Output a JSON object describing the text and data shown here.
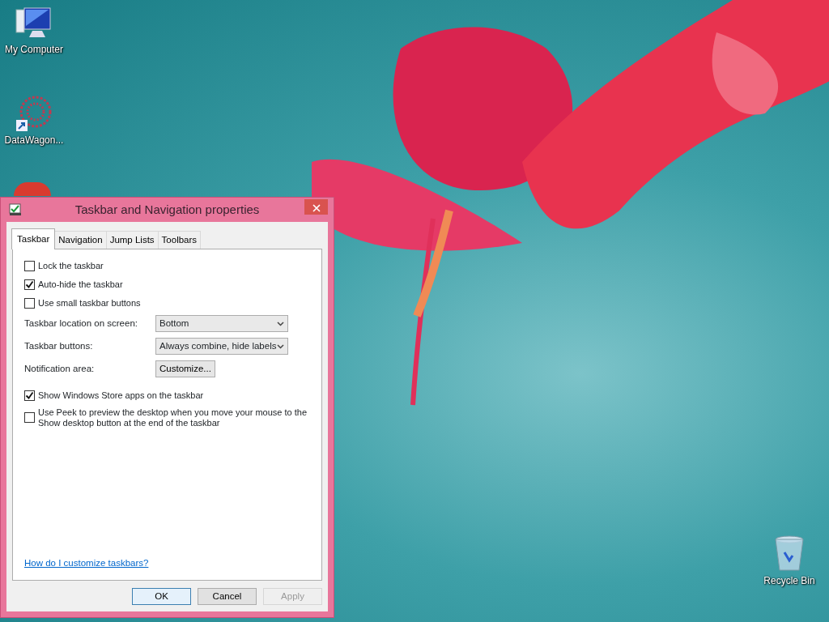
{
  "desktop_icons": [
    {
      "label": "My Computer",
      "kind": "computer"
    },
    {
      "label": "DataWagon...",
      "kind": "shortcut"
    },
    {
      "label": "Recycle Bin",
      "kind": "bin"
    }
  ],
  "dialog": {
    "title": "Taskbar and Navigation properties",
    "tabs": [
      {
        "label": "Taskbar",
        "selected": true
      },
      {
        "label": "Navigation",
        "selected": false
      },
      {
        "label": "Jump Lists",
        "selected": false
      },
      {
        "label": "Toolbars",
        "selected": false
      }
    ],
    "rows": [
      {
        "kind": "checkbox",
        "label": "Lock the taskbar",
        "checked": false
      },
      {
        "kind": "checkbox",
        "label": "Auto-hide the taskbar",
        "checked": true
      },
      {
        "kind": "checkbox",
        "label": "Use small taskbar buttons",
        "checked": false
      },
      {
        "kind": "select",
        "label": "Taskbar location on screen:",
        "value": "Bottom"
      },
      {
        "kind": "select",
        "label": "Taskbar buttons:",
        "value": "Always combine, hide labels"
      },
      {
        "kind": "button",
        "label": "Notification area:",
        "button": "Customize..."
      },
      {
        "kind": "checkbox",
        "label": "Show Windows Store apps on the taskbar",
        "checked": true
      },
      {
        "kind": "checkbox",
        "label": "Use Peek to preview the desktop when you move your mouse to the\nShow desktop button at the end of the taskbar",
        "checked": false
      }
    ],
    "help_link": "How do I customize taskbars?",
    "buttons": [
      {
        "label": "OK",
        "default": true,
        "disabled": false
      },
      {
        "label": "Cancel",
        "default": false,
        "disabled": false
      },
      {
        "label": "Apply",
        "default": false,
        "disabled": true
      }
    ]
  }
}
